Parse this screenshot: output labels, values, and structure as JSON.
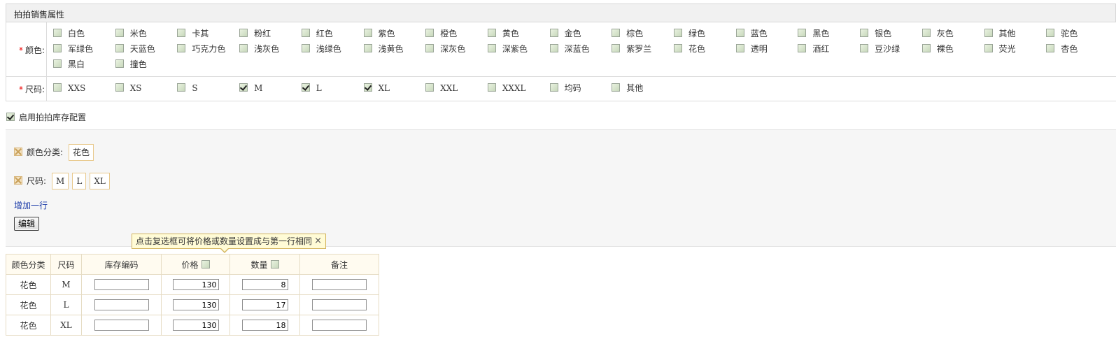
{
  "header": {
    "title": "拍拍销售属性"
  },
  "color": {
    "label": "颜色:",
    "options": [
      {
        "label": "白色",
        "checked": false
      },
      {
        "label": "米色",
        "checked": false
      },
      {
        "label": "卡其",
        "checked": false
      },
      {
        "label": "粉红",
        "checked": false
      },
      {
        "label": "红色",
        "checked": false
      },
      {
        "label": "紫色",
        "checked": false
      },
      {
        "label": "橙色",
        "checked": false
      },
      {
        "label": "黄色",
        "checked": false
      },
      {
        "label": "金色",
        "checked": false
      },
      {
        "label": "棕色",
        "checked": false
      },
      {
        "label": "绿色",
        "checked": false
      },
      {
        "label": "蓝色",
        "checked": false
      },
      {
        "label": "黑色",
        "checked": false
      },
      {
        "label": "银色",
        "checked": false
      },
      {
        "label": "灰色",
        "checked": false
      },
      {
        "label": "其他",
        "checked": false
      },
      {
        "label": "驼色",
        "checked": false
      },
      {
        "label": "军绿色",
        "checked": false
      },
      {
        "label": "天蓝色",
        "checked": false
      },
      {
        "label": "巧克力色",
        "checked": false
      },
      {
        "label": "浅灰色",
        "checked": false
      },
      {
        "label": "浅绿色",
        "checked": false
      },
      {
        "label": "浅黄色",
        "checked": false
      },
      {
        "label": "深灰色",
        "checked": false
      },
      {
        "label": "深紫色",
        "checked": false
      },
      {
        "label": "深蓝色",
        "checked": false
      },
      {
        "label": "紫罗兰",
        "checked": false
      },
      {
        "label": "花色",
        "checked": false
      },
      {
        "label": "透明",
        "checked": false
      },
      {
        "label": "酒红",
        "checked": false
      },
      {
        "label": "豆沙绿",
        "checked": false
      },
      {
        "label": "裸色",
        "checked": false
      },
      {
        "label": "荧光",
        "checked": false
      },
      {
        "label": "杏色",
        "checked": false
      },
      {
        "label": "黑白",
        "checked": false
      },
      {
        "label": "撞色",
        "checked": false
      }
    ]
  },
  "size": {
    "label": "尺码:",
    "options": [
      {
        "label": "XXS",
        "checked": false
      },
      {
        "label": "XS",
        "checked": false
      },
      {
        "label": "S",
        "checked": false
      },
      {
        "label": "M",
        "checked": true
      },
      {
        "label": "L",
        "checked": true
      },
      {
        "label": "XL",
        "checked": true
      },
      {
        "label": "XXL",
        "checked": false
      },
      {
        "label": "XXXL",
        "checked": false
      },
      {
        "label": "均码",
        "checked": false
      },
      {
        "label": "其他",
        "checked": false
      }
    ]
  },
  "stock_config": {
    "enable_label": "启用拍拍库存配置",
    "enabled": true,
    "color_category_label": "颜色分类:",
    "color_values": [
      "花色"
    ],
    "size_label": "尺码:",
    "size_values": [
      "M",
      "L",
      "XL"
    ],
    "add_row_label": "增加一行",
    "edit_label": "编辑"
  },
  "tooltip": {
    "text": "点击复选框可将价格或数量设置成与第一行相同",
    "close": "×"
  },
  "table": {
    "headers": {
      "color": "颜色分类",
      "size": "尺码",
      "sku": "库存编码",
      "price": "价格",
      "qty": "数量",
      "note": "备注"
    },
    "rows": [
      {
        "color": "花色",
        "size": "M",
        "sku": "",
        "price": "130",
        "qty": "8",
        "note": ""
      },
      {
        "color": "花色",
        "size": "L",
        "sku": "",
        "price": "130",
        "qty": "17",
        "note": ""
      },
      {
        "color": "花色",
        "size": "XL",
        "sku": "",
        "price": "130",
        "qty": "18",
        "note": ""
      }
    ]
  }
}
